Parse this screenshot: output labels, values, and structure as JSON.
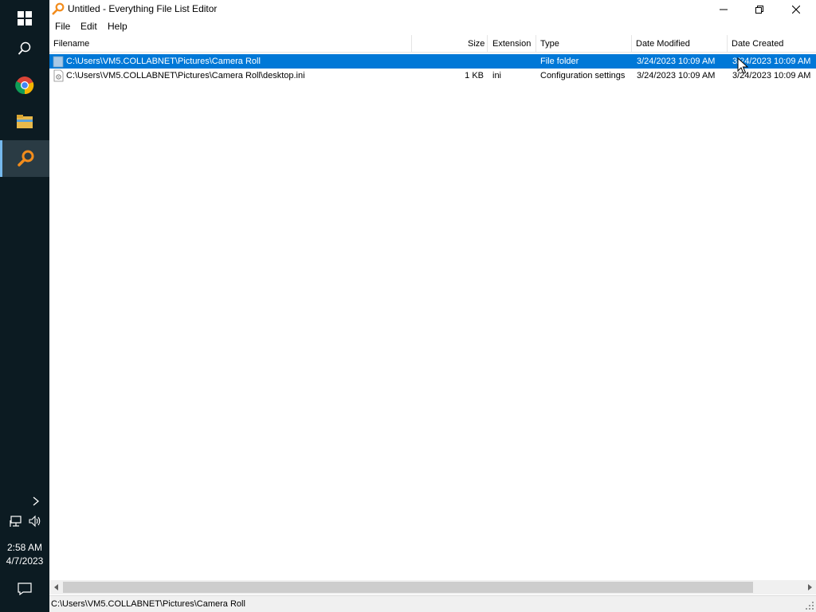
{
  "taskbar": {
    "items": [
      {
        "name": "start",
        "icon": "windows-logo-icon"
      },
      {
        "name": "search",
        "icon": "search-icon"
      },
      {
        "name": "chrome",
        "icon": "chrome-icon"
      },
      {
        "name": "file-explorer",
        "icon": "folder-icon"
      },
      {
        "name": "everything",
        "icon": "everything-magnifier-icon",
        "active": true
      }
    ],
    "clock": {
      "time": "2:58 AM",
      "date": "4/7/2023"
    }
  },
  "window": {
    "title": "Untitled - Everything File List Editor",
    "menu": [
      "File",
      "Edit",
      "Help"
    ]
  },
  "columns": [
    "Filename",
    "Size",
    "Extension",
    "Type",
    "Date Modified",
    "Date Created"
  ],
  "rows": [
    {
      "filename": "C:\\Users\\VM5.COLLABNET\\Pictures\\Camera Roll",
      "size": "",
      "extension": "",
      "type": "File folder",
      "modified": "3/24/2023 10:09 AM",
      "created": "3/24/2023 10:09 AM",
      "selected": true,
      "icon": "folder-icon"
    },
    {
      "filename": "C:\\Users\\VM5.COLLABNET\\Pictures\\Camera Roll\\desktop.ini",
      "size": "1 KB",
      "extension": "ini",
      "type": "Configuration settings",
      "modified": "3/24/2023 10:09 AM",
      "created": "3/24/2023 10:09 AM",
      "selected": false,
      "icon": "settings-file-icon"
    }
  ],
  "status": "C:\\Users\\VM5.COLLABNET\\Pictures\\Camera Roll",
  "colors": {
    "selection": "#0078d7",
    "taskbar": "#0c1b22",
    "accent": "#76b9ed"
  }
}
